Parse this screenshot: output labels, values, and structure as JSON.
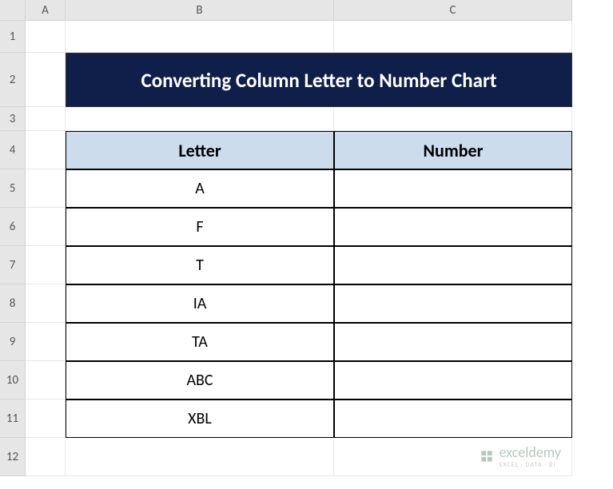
{
  "columns": [
    "",
    "A",
    "B",
    "C"
  ],
  "rows": [
    "1",
    "2",
    "3",
    "4",
    "5",
    "6",
    "7",
    "8",
    "9",
    "10",
    "11",
    "12"
  ],
  "title": "Converting Column Letter to Number Chart",
  "table": {
    "headers": [
      "Letter",
      "Number"
    ],
    "data": [
      [
        "A",
        ""
      ],
      [
        "F",
        ""
      ],
      [
        "T",
        ""
      ],
      [
        "IA",
        ""
      ],
      [
        "TA",
        ""
      ],
      [
        "ABC",
        ""
      ],
      [
        "XBL",
        ""
      ]
    ]
  },
  "watermark": {
    "name": "exceldemy",
    "sub": "EXCEL · DATA · BI"
  },
  "chart_data": {
    "type": "table",
    "title": "Converting Column Letter to Number Chart",
    "columns": [
      "Letter",
      "Number"
    ],
    "rows": [
      {
        "Letter": "A",
        "Number": null
      },
      {
        "Letter": "F",
        "Number": null
      },
      {
        "Letter": "T",
        "Number": null
      },
      {
        "Letter": "IA",
        "Number": null
      },
      {
        "Letter": "TA",
        "Number": null
      },
      {
        "Letter": "ABC",
        "Number": null
      },
      {
        "Letter": "XBL",
        "Number": null
      }
    ]
  }
}
